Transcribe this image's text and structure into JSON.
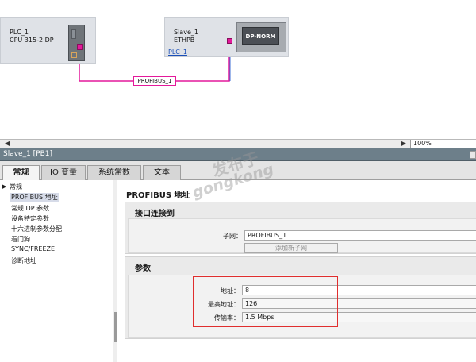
{
  "network": {
    "plc": {
      "name": "PLC_1",
      "type": "CPU 315-2 DP"
    },
    "slave": {
      "name": "Slave_1",
      "type": "ETHPB",
      "link": "PLC_1",
      "module_label": "DP-NORM"
    },
    "bus_label": "PROFIBUS_1",
    "colors": {
      "bus": "#e4199b",
      "slave_link": "#3f6fd6"
    }
  },
  "scrollbar": {
    "zoom": "100%"
  },
  "inspector": {
    "title": "Slave_1 [PB1]",
    "tabs": [
      {
        "label": "常规",
        "active": true
      },
      {
        "label": "IO 变量",
        "active": false
      },
      {
        "label": "系统常数",
        "active": false
      },
      {
        "label": "文本",
        "active": false
      }
    ],
    "nav": {
      "root": "常规",
      "items": [
        {
          "label": "PROFIBUS 地址",
          "selected": true
        },
        {
          "label": "常规 DP 参数",
          "selected": false
        },
        {
          "label": "设备特定参数",
          "selected": false
        },
        {
          "label": "十六进制参数分配",
          "selected": false
        },
        {
          "label": "看门狗",
          "selected": false
        },
        {
          "label": "SYNC/FREEZE",
          "selected": false
        },
        {
          "label": "诊断地址",
          "selected": false
        }
      ]
    },
    "section_title": "PROFIBUS 地址",
    "interface": {
      "title": "接口连接到",
      "subnet_label": "子网：",
      "subnet_value": "PROFIBUS_1",
      "add_subnet_button": "添加新子网"
    },
    "params": {
      "title": "参数",
      "address_label": "地址：",
      "address_value": "8",
      "highest_label": "最高地址：",
      "highest_value": "126",
      "rate_label": "传输率：",
      "rate_value": "1.5 Mbps"
    }
  },
  "watermark": {
    "cn": "发布于",
    "en": "gongkong"
  }
}
